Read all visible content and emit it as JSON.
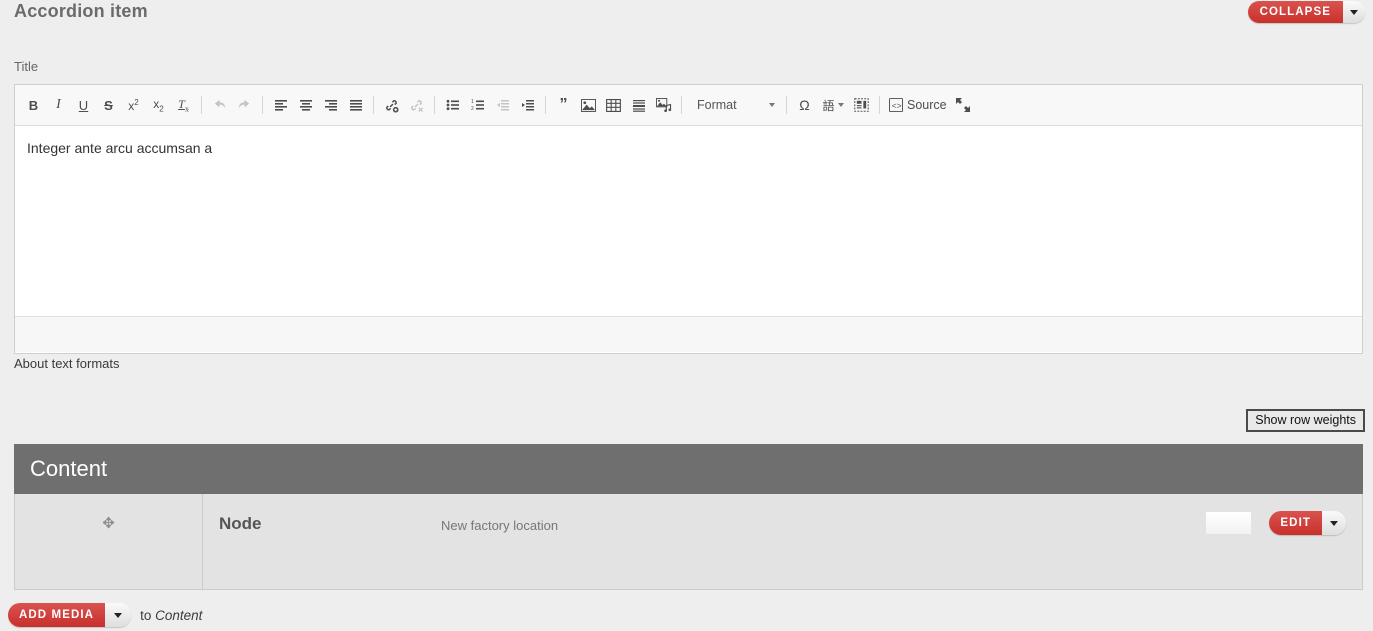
{
  "accordion": {
    "title": "Accordion item",
    "collapse_label": "COLLAPSE",
    "collapse_caret_name": "caret-down"
  },
  "title_field": {
    "label": "Title",
    "value": "",
    "placeholder": ""
  },
  "editor": {
    "body_text": "Integer ante arcu accumsan a",
    "format_label": "Format",
    "source_label": "Source",
    "about_link": "About text formats",
    "toolbar": [
      {
        "name": "bold-icon",
        "glyph": "B",
        "disabled": false
      },
      {
        "name": "italic-icon",
        "glyph": "I",
        "disabled": false
      },
      {
        "name": "underline-icon",
        "glyph": "U",
        "disabled": false
      },
      {
        "name": "strikethrough-icon",
        "glyph": "S",
        "disabled": false
      },
      {
        "name": "superscript-icon",
        "glyph": "x²",
        "disabled": false
      },
      {
        "name": "subscript-icon",
        "glyph": "x₂",
        "disabled": false
      },
      {
        "name": "remove-format-icon",
        "glyph": "Tx",
        "disabled": false
      },
      {
        "name": "separator",
        "glyph": "",
        "disabled": false
      },
      {
        "name": "undo-icon",
        "glyph": "↶",
        "disabled": true
      },
      {
        "name": "redo-icon",
        "glyph": "↷",
        "disabled": true
      },
      {
        "name": "separator",
        "glyph": "",
        "disabled": false
      },
      {
        "name": "align-left-icon",
        "glyph": "",
        "disabled": false
      },
      {
        "name": "align-center-icon",
        "glyph": "",
        "disabled": false
      },
      {
        "name": "align-right-icon",
        "glyph": "",
        "disabled": false
      },
      {
        "name": "align-justify-icon",
        "glyph": "",
        "disabled": false
      },
      {
        "name": "separator",
        "glyph": "",
        "disabled": false
      },
      {
        "name": "link-icon",
        "glyph": "",
        "disabled": false
      },
      {
        "name": "unlink-icon",
        "glyph": "",
        "disabled": true
      },
      {
        "name": "separator",
        "glyph": "",
        "disabled": false
      },
      {
        "name": "bulleted-list-icon",
        "glyph": "",
        "disabled": false
      },
      {
        "name": "numbered-list-icon",
        "glyph": "",
        "disabled": false
      },
      {
        "name": "outdent-icon",
        "glyph": "",
        "disabled": true
      },
      {
        "name": "indent-icon",
        "glyph": "",
        "disabled": false
      },
      {
        "name": "separator",
        "glyph": "",
        "disabled": false
      },
      {
        "name": "blockquote-icon",
        "glyph": "",
        "disabled": false
      },
      {
        "name": "image-icon",
        "glyph": "",
        "disabled": false
      },
      {
        "name": "table-icon",
        "glyph": "",
        "disabled": false
      },
      {
        "name": "horizontal-rule-icon",
        "glyph": "",
        "disabled": false
      },
      {
        "name": "media-embed-icon",
        "glyph": "",
        "disabled": false
      },
      {
        "name": "separator",
        "glyph": "",
        "disabled": false
      },
      {
        "name": "special-character-icon",
        "glyph": "Ω",
        "disabled": false
      },
      {
        "name": "language-icon",
        "glyph": "語",
        "disabled": false
      },
      {
        "name": "template-icon",
        "glyph": "",
        "disabled": false
      },
      {
        "name": "source-button",
        "glyph": "",
        "disabled": false
      },
      {
        "name": "maximize-icon",
        "glyph": "",
        "disabled": false
      }
    ]
  },
  "row_weights": {
    "button_label": "Show row weights"
  },
  "content_table": {
    "header": "Content",
    "rows": [
      {
        "drag_handle": "drag-handle-icon",
        "type": "Node",
        "title": "New factory location",
        "edit_label": "EDIT"
      }
    ]
  },
  "footer": {
    "add_media_label": "ADD MEDIA",
    "suffix_prefix": "to ",
    "suffix_target": "Content"
  },
  "colors": {
    "page_bg": "#eeeeee",
    "accent_red": "#d9534f",
    "content_header": "#6f6f6f",
    "row_bg": "#e3e3e3"
  }
}
